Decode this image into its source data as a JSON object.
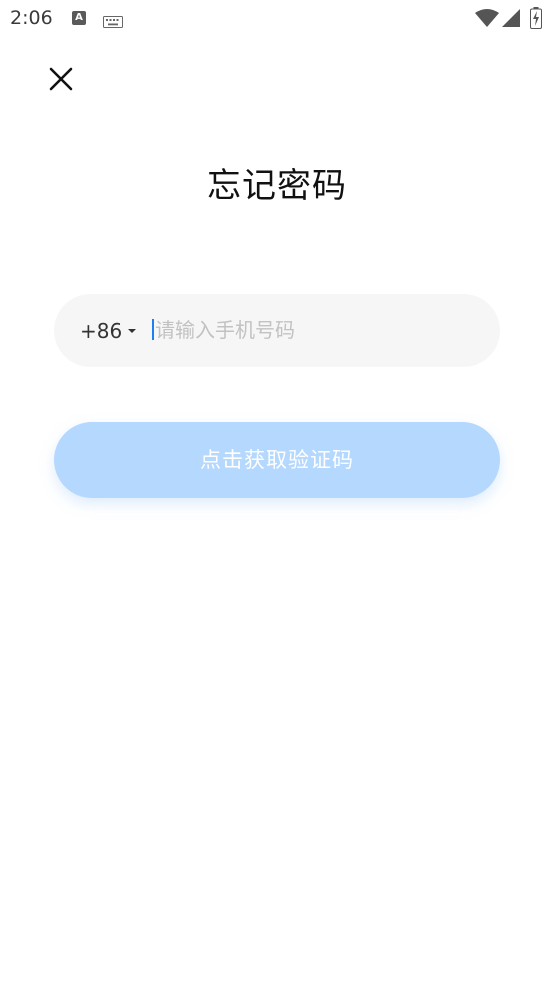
{
  "status_bar": {
    "time": "2:06",
    "a_badge": "A",
    "icons": [
      "a-notification-icon",
      "keyboard-icon",
      "wifi-icon",
      "cell-signal-icon",
      "battery-icon"
    ]
  },
  "header": {
    "close_icon": "close-icon"
  },
  "title": "忘记密码",
  "phone_field": {
    "country_code": "+86",
    "placeholder": "请输入手机号码",
    "value": ""
  },
  "get_code_button": {
    "label": "点击获取验证码"
  },
  "colors": {
    "button_bg": "#b5d8fe",
    "field_bg": "#f6f6f6",
    "cursor": "#1e7ef2"
  }
}
